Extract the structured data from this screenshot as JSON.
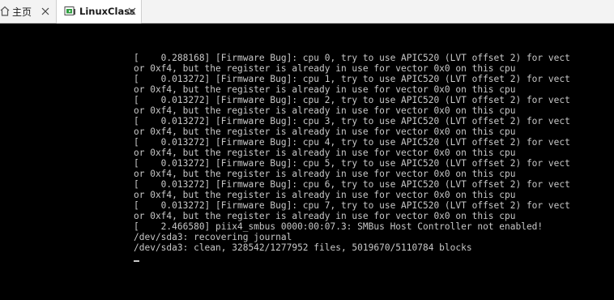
{
  "tabs": [
    {
      "label": "主页",
      "icon": "home-icon"
    },
    {
      "label": "LinuxClass",
      "icon": "vm-icon"
    }
  ],
  "console": {
    "lines": [
      "[    0.288168] [Firmware Bug]: cpu 0, try to use APIC520 (LVT offset 2) for vect",
      "or 0xf4, but the register is already in use for vector 0x0 on this cpu",
      "[    0.013272] [Firmware Bug]: cpu 1, try to use APIC520 (LVT offset 2) for vect",
      "or 0xf4, but the register is already in use for vector 0x0 on this cpu",
      "[    0.013272] [Firmware Bug]: cpu 2, try to use APIC520 (LVT offset 2) for vect",
      "or 0xf4, but the register is already in use for vector 0x0 on this cpu",
      "[    0.013272] [Firmware Bug]: cpu 3, try to use APIC520 (LVT offset 2) for vect",
      "or 0xf4, but the register is already in use for vector 0x0 on this cpu",
      "[    0.013272] [Firmware Bug]: cpu 4, try to use APIC520 (LVT offset 2) for vect",
      "or 0xf4, but the register is already in use for vector 0x0 on this cpu",
      "[    0.013272] [Firmware Bug]: cpu 5, try to use APIC520 (LVT offset 2) for vect",
      "or 0xf4, but the register is already in use for vector 0x0 on this cpu",
      "[    0.013272] [Firmware Bug]: cpu 6, try to use APIC520 (LVT offset 2) for vect",
      "or 0xf4, but the register is already in use for vector 0x0 on this cpu",
      "[    0.013272] [Firmware Bug]: cpu 7, try to use APIC520 (LVT offset 2) for vect",
      "or 0xf4, but the register is already in use for vector 0x0 on this cpu",
      "[    2.466580] piix4_smbus 0000:00:07.3: SMBus Host Controller not enabled!",
      "/dev/sda3: recovering journal",
      "/dev/sda3: clean, 328542/1277952 files, 5019670/5110784 blocks"
    ]
  },
  "colors": {
    "console_bg": "#000000",
    "console_text": "#c8c8c8",
    "tabbar_bg": "#f3f3f3",
    "vm_icon_green": "#2e9e3f"
  }
}
